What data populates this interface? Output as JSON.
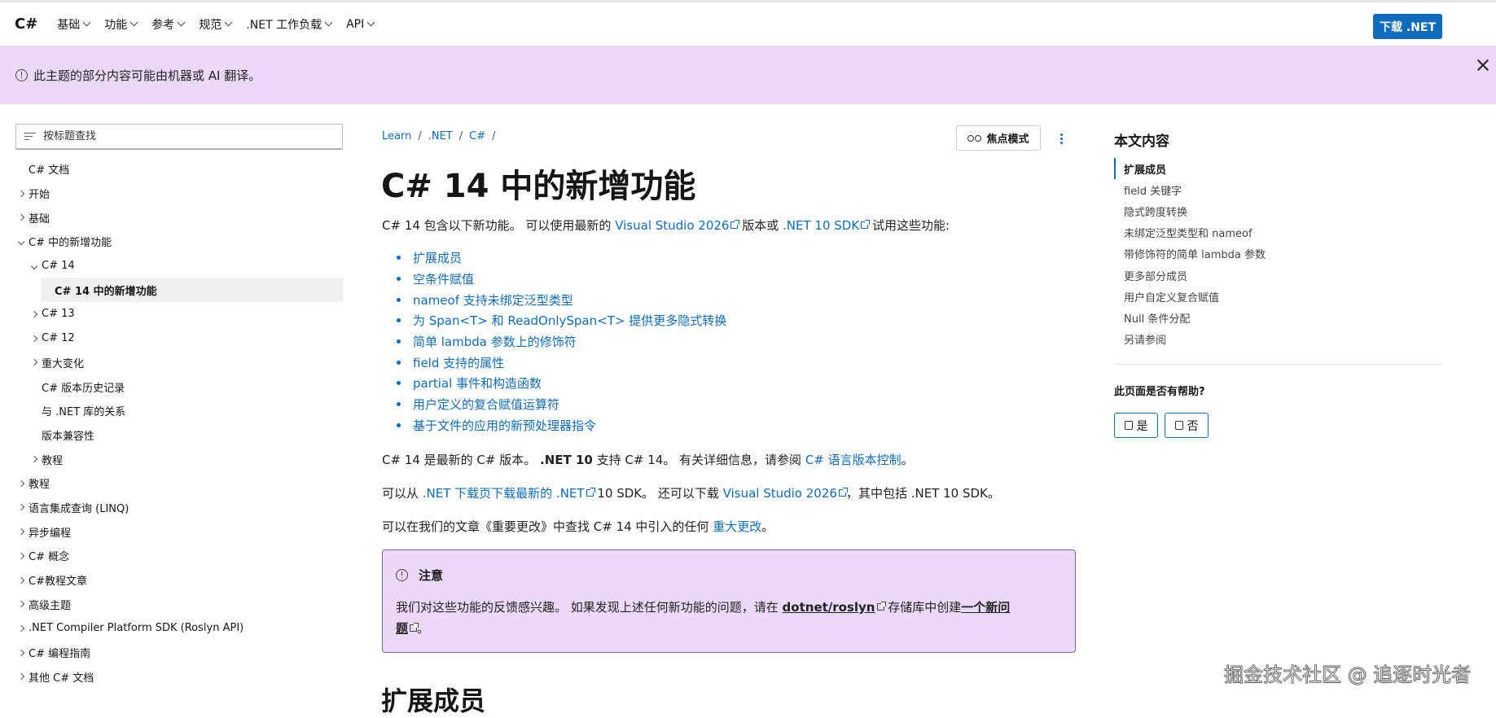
{
  "topnav": {
    "brand": "C#",
    "items": [
      {
        "label": "基础"
      },
      {
        "label": "功能"
      },
      {
        "label": "参考"
      },
      {
        "label": "规范"
      },
      {
        "label": ".NET 工作负载"
      },
      {
        "label": "API"
      }
    ],
    "download_label": "下载 .NET"
  },
  "banner": {
    "text": "此主题的部分内容可能由机器或 AI 翻译。"
  },
  "sidebar": {
    "filter_placeholder": "按标题查找",
    "items": [
      {
        "label": "C# 文档",
        "level": 0,
        "chevron": "none"
      },
      {
        "label": "开始",
        "level": 0,
        "chevron": "closed"
      },
      {
        "label": "基础",
        "level": 0,
        "chevron": "closed"
      },
      {
        "label": "C# 中的新增功能",
        "level": 0,
        "chevron": "open"
      },
      {
        "label": "C# 14",
        "level": 1,
        "chevron": "open"
      },
      {
        "label": "C# 14 中的新增功能",
        "level": 2,
        "chevron": "none",
        "active": true
      },
      {
        "label": "C# 13",
        "level": 1,
        "chevron": "closed"
      },
      {
        "label": "C# 12",
        "level": 1,
        "chevron": "closed"
      },
      {
        "label": "重大变化",
        "level": 1,
        "chevron": "closed"
      },
      {
        "label": "C# 版本历史记录",
        "level": 1,
        "chevron": "none"
      },
      {
        "label": "与 .NET 库的关系",
        "level": 1,
        "chevron": "none"
      },
      {
        "label": "版本兼容性",
        "level": 1,
        "chevron": "none"
      },
      {
        "label": "教程",
        "level": 1,
        "chevron": "closed"
      },
      {
        "label": "教程",
        "level": 0,
        "chevron": "closed"
      },
      {
        "label": "语言集成查询 (LINQ)",
        "level": 0,
        "chevron": "closed"
      },
      {
        "label": "异步编程",
        "level": 0,
        "chevron": "closed"
      },
      {
        "label": "C# 概念",
        "level": 0,
        "chevron": "closed"
      },
      {
        "label": "C#教程文章",
        "level": 0,
        "chevron": "closed"
      },
      {
        "label": "高级主题",
        "level": 0,
        "chevron": "closed"
      },
      {
        "label": ".NET Compiler Platform SDK (Roslyn API)",
        "level": 0,
        "chevron": "closed"
      },
      {
        "label": "C# 编程指南",
        "level": 0,
        "chevron": "closed"
      },
      {
        "label": "其他 C# 文档",
        "level": 0,
        "chevron": "closed"
      }
    ]
  },
  "breadcrumb": {
    "items": [
      "Learn",
      ".NET",
      "C#"
    ],
    "separator": "/"
  },
  "actions": {
    "focus_label": "焦点模式"
  },
  "article": {
    "title": "C# 14 中的新增功能",
    "intro": {
      "text1": "C# 14 包含以下新功能。 可以使用最新的 ",
      "link1": "Visual Studio 2026",
      "text2": " 版本或 ",
      "link2": ".NET 10 SDK",
      "text3": " 试用这些功能:"
    },
    "features": [
      "扩展成员",
      "空条件赋值",
      "nameof 支持未绑定泛型类型",
      "为 Span<T> 和 ReadOnlySpan<T> 提供更多隐式转换",
      "简单 lambda 参数上的修饰符",
      "field 支持的属性",
      "partial 事件和构造函数",
      "用户定义的复合赋值运算符",
      "基于文件的应用的新预处理器指令"
    ],
    "p2": {
      "text1": "C# 14 是最新的 C# 版本。 ",
      "bold": ".NET 10",
      "text2": " 支持 C# 14。 有关详细信息，请参阅 ",
      "link": "C# 语言版本控制",
      "text3": "。"
    },
    "p3": {
      "text1": "可以从 ",
      "link1": ".NET 下载页下载最新的 .NET",
      "text2": " 10 SDK。 还可以下载 ",
      "link2": "Visual Studio 2026",
      "text3": "，其中包括 .NET 10 SDK。"
    },
    "p4": {
      "text1": "可以在我们的文章《重要更改》中查找 C# 14 中引入的任何 ",
      "link": "重大更改",
      "text2": "。"
    },
    "note": {
      "title": "注意",
      "text1": "我们对这些功能的反馈感兴趣。 如果发现上述任何新功能的问题，请在 ",
      "link1": "dotnet/roslyn",
      "text2": " 存储库中创建",
      "link2a": "一个新问",
      "link2b": "题",
      "text3": "。"
    },
    "section_heading": "扩展成员"
  },
  "in_this_article": {
    "title": "本文内容",
    "items": [
      "扩展成员",
      "field 关键字",
      "隐式跨度转换",
      "未绑定泛型类型和 nameof",
      "带修饰符的简单 lambda 参数",
      "更多部分成员",
      "用户自定义复合赋值",
      "Null 条件分配",
      "另请参阅"
    ]
  },
  "feedback": {
    "question": "此页面是否有帮助?",
    "yes": "是",
    "no": "否"
  },
  "watermark": "掘金技术社区 @ 追逐时光者",
  "colors": {
    "accent": "#0f6cbd",
    "banner_bg": "#ecd8f8",
    "note_border": "#8a5a9e"
  }
}
